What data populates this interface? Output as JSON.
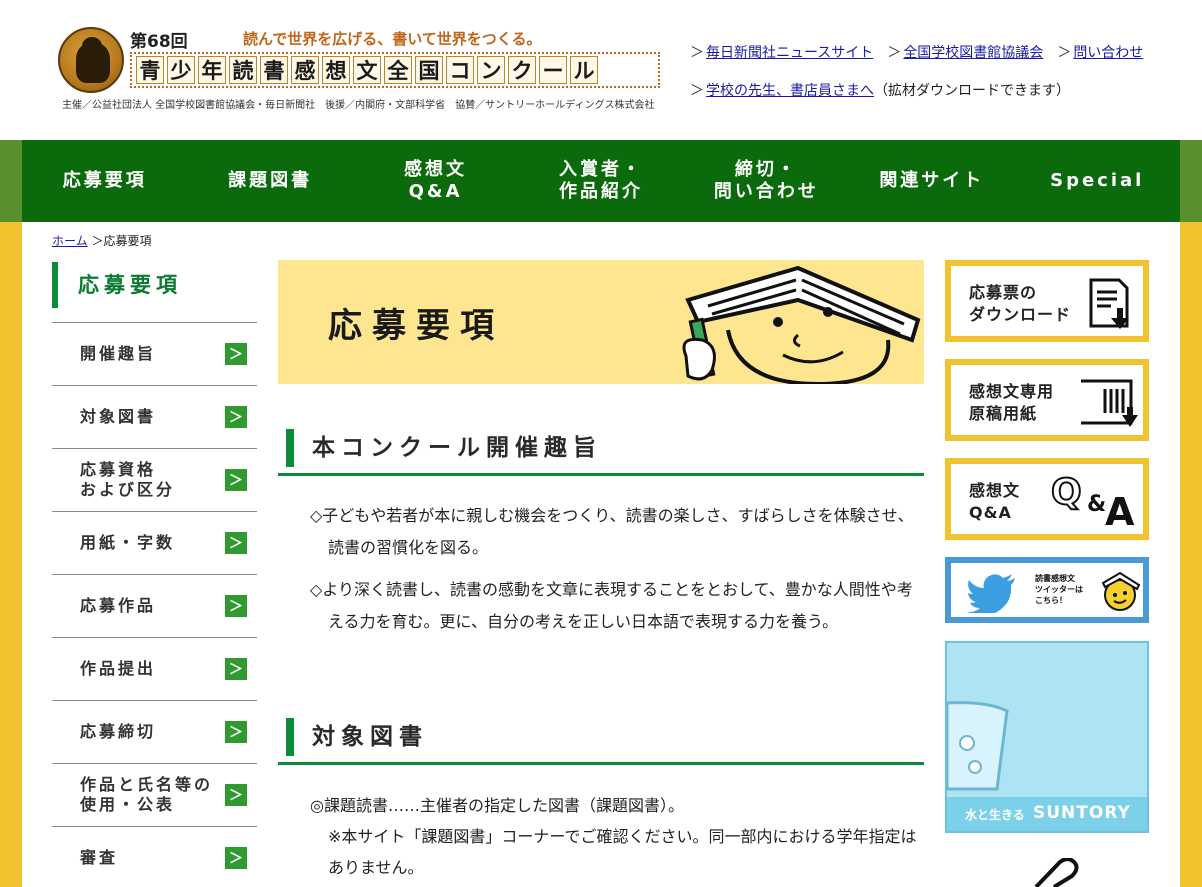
{
  "header": {
    "edition": "第68回",
    "tagline": "読んで世界を広げる、書いて世界をつくる。",
    "brand_chars": [
      "青",
      "少",
      "年",
      "読",
      "書",
      "感",
      "想",
      "文",
      "全",
      "国",
      "コ",
      "ン",
      "ク",
      "ー",
      "ル"
    ],
    "sponsors": "主催／公益社団法人 全国学校図書館協議会・毎日新聞社　後援／内閣府・文部科学省　協賛／サントリーホールディングス株式会社",
    "links": [
      {
        "label": "毎日新聞社ニュースサイト"
      },
      {
        "label": "全国学校図書館協議会"
      },
      {
        "label": "問い合わせ"
      }
    ],
    "teacher_link": "学校の先生、書店員さまへ",
    "teacher_note": "（拡材ダウンロードできます）",
    "arrow": "＞"
  },
  "nav": [
    {
      "line1": "応募要項",
      "line2": ""
    },
    {
      "line1": "課題図書",
      "line2": ""
    },
    {
      "line1": "感想文",
      "line2": "Q&A"
    },
    {
      "line1": "入賞者・",
      "line2": "作品紹介"
    },
    {
      "line1": "締切・",
      "line2": "問い合わせ"
    },
    {
      "line1": "関連サイト",
      "line2": ""
    },
    {
      "line1": "Special",
      "line2": ""
    }
  ],
  "breadcrumb": {
    "home": "ホーム",
    "sep": "＞",
    "current": "応募要項"
  },
  "sidebar": {
    "title": "応募要項",
    "items": [
      {
        "line1": "開催趣旨",
        "line2": ""
      },
      {
        "line1": "対象図書",
        "line2": ""
      },
      {
        "line1": "応募資格",
        "line2": "および区分"
      },
      {
        "line1": "用紙・字数",
        "line2": ""
      },
      {
        "line1": "応募作品",
        "line2": ""
      },
      {
        "line1": "作品提出",
        "line2": ""
      },
      {
        "line1": "応募締切",
        "line2": ""
      },
      {
        "line1": "作品と氏名等の",
        "line2": "使用・公表"
      },
      {
        "line1": "審査",
        "line2": ""
      }
    ],
    "chevron": "＞"
  },
  "main": {
    "banner_title": "応募要項",
    "section1": {
      "heading": "本コンクール開催趣旨",
      "p1": "◇子どもや若者が本に親しむ機会をつくり、読書の楽しさ、すばらしさを体験させ、読書の習慣化を図る。",
      "p2": "◇より深く読書し、読書の感動を文章に表現することをとおして、豊かな人間性や考える力を育む。更に、自分の考えを正しい日本語で表現する力を養う。"
    },
    "section2": {
      "heading": "対象図書",
      "p1": "◎課題読書……主催者の指定した図書（課題図書）。",
      "p2": "※本サイト「課題図書」コーナーでご確認ください。同一部内における学年指定はありません。"
    }
  },
  "right": {
    "download": {
      "line1": "応募票の",
      "line2": "ダウンロード"
    },
    "paper": {
      "line1": "感想文専用",
      "line2": "原稿用紙"
    },
    "qa": {
      "line1": "感想文",
      "line2": "Q&A",
      "q": "Q",
      "amp": "&",
      "a": "A"
    },
    "twitter": {
      "line1": "読書感想文",
      "line2": "ツイッターは",
      "line3": "こちら！"
    },
    "suntory": {
      "caption": "水と生きる",
      "brand": "SUNTORY"
    }
  },
  "colors": {
    "nav_green": "#0b6a0b",
    "accent_green": "#0b8a3a",
    "frame_yellow": "#f2c12e",
    "banner_yellow": "#fde68f",
    "link_blue": "#1a1aa8"
  }
}
